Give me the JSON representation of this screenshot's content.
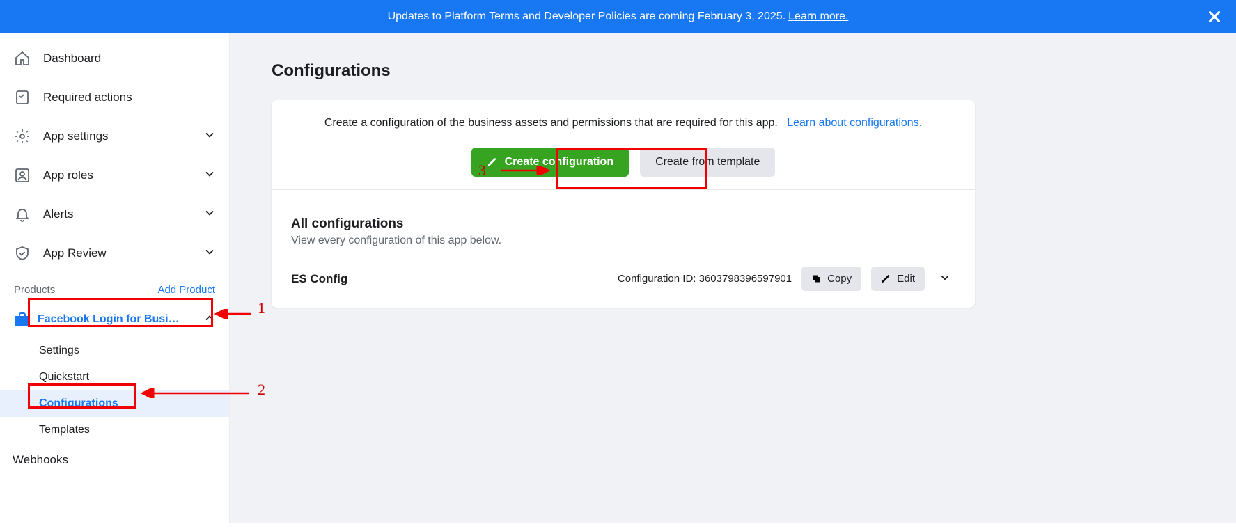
{
  "banner": {
    "text": "Updates to Platform Terms and Developer Policies are coming February 3, 2025.",
    "link": "Learn more."
  },
  "sidebar": {
    "items": [
      {
        "label": "Dashboard"
      },
      {
        "label": "Required actions"
      },
      {
        "label": "App settings"
      },
      {
        "label": "App roles"
      },
      {
        "label": "Alerts"
      },
      {
        "label": "App Review"
      }
    ],
    "products_header": "Products",
    "add_product": "Add Product",
    "fblogin": {
      "title": "Facebook Login for Busi…",
      "sub": [
        {
          "label": "Settings"
        },
        {
          "label": "Quickstart"
        },
        {
          "label": "Configurations"
        },
        {
          "label": "Templates"
        }
      ]
    },
    "webhooks": "Webhooks"
  },
  "page": {
    "title": "Configurations",
    "intro_text": "Create a configuration of the business assets and permissions that are required for this app.",
    "intro_link": "Learn about configurations.",
    "create": "Create configuration",
    "template": "Create from template",
    "list_title": "All configurations",
    "list_sub": "View every configuration of this app below.",
    "config_name": "ES Config",
    "config_id_label": "Configuration ID: ",
    "config_id": "3603798396597901",
    "copy": "Copy",
    "edit": "Edit"
  },
  "ann": {
    "n1": "1",
    "n2": "2",
    "n3": "3"
  }
}
